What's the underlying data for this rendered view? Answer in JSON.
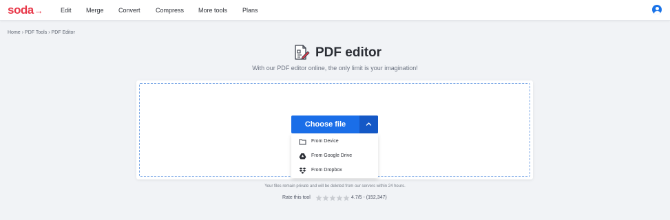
{
  "header": {
    "logo_text": "soda",
    "nav": [
      {
        "label": "Edit"
      },
      {
        "label": "Merge"
      },
      {
        "label": "Convert"
      },
      {
        "label": "Compress"
      },
      {
        "label": "More tools"
      },
      {
        "label": "Plans"
      }
    ],
    "user_icon": "user-account-icon",
    "brand_color": "#e8394a",
    "accent_color": "#1a6ee8"
  },
  "breadcrumb": {
    "items": [
      "Home",
      "PDF Tools",
      "PDF Editor"
    ],
    "separator": "›"
  },
  "main": {
    "title": "PDF editor",
    "title_icon": "pdf-edit-icon",
    "subtitle": "With our PDF editor online, the only limit is your imagination!",
    "choose_file_label": "Choose file",
    "toggle_icon": "chevron-up-icon",
    "menu": [
      {
        "label": "From Device",
        "icon": "folder-icon"
      },
      {
        "label": "From Google Drive",
        "icon": "google-drive-icon"
      },
      {
        "label": "From Dropbox",
        "icon": "dropbox-icon"
      }
    ],
    "privacy_note": "Your files remain private and will be deleted from our servers within 24 hours.",
    "rating": {
      "label": "Rate this tool",
      "max_stars": 5,
      "value_text": "4.7/5 - (152,347)"
    }
  }
}
